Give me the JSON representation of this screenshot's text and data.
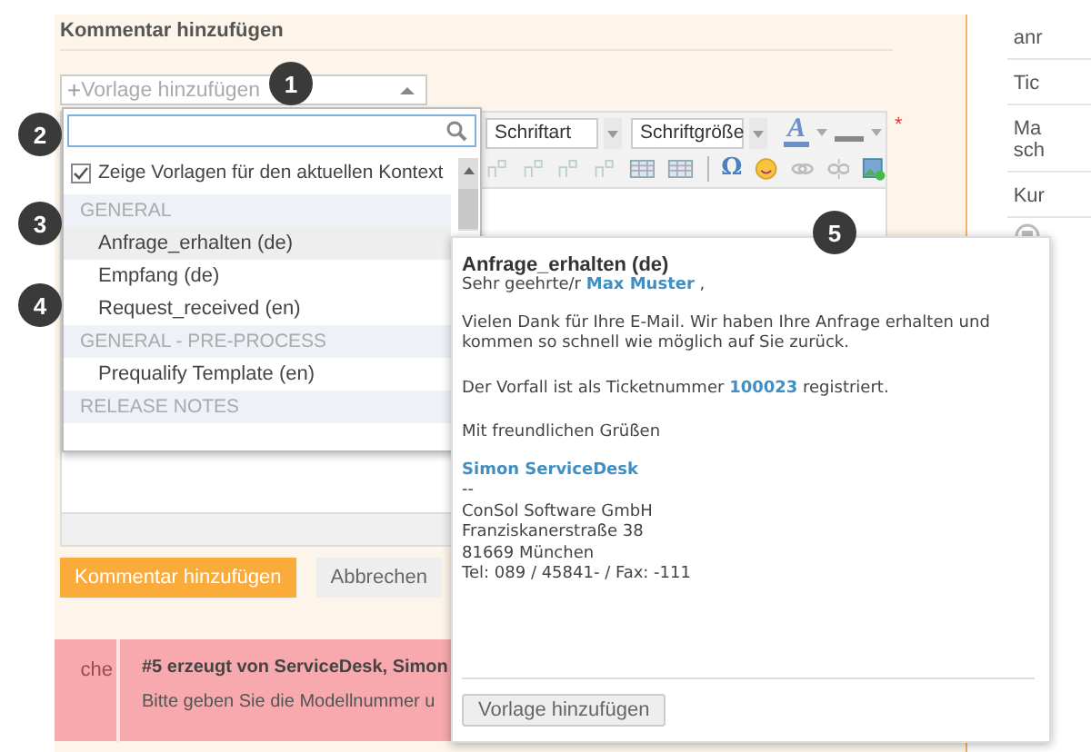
{
  "panel": {
    "title": "Kommentar hinzufügen"
  },
  "template_select": {
    "prefix": "+",
    "placeholder": "Vorlage hinzufügen",
    "expanded": true
  },
  "dropdown": {
    "context_filter": {
      "label": "Zeige Vorlagen für den aktuellen Kontext",
      "checked": true
    },
    "groups": [
      {
        "title": "GENERAL",
        "items": [
          {
            "label": "Anfrage_erhalten (de)",
            "selected": true
          },
          {
            "label": "Empfang (de)",
            "selected": false
          },
          {
            "label": "Request_received (en)",
            "selected": false
          }
        ]
      },
      {
        "title": "GENERAL - PRE-PROCESS",
        "items": [
          {
            "label": "Prequalify Template (en)",
            "selected": false
          }
        ]
      },
      {
        "title": "RELEASE NOTES"
      }
    ]
  },
  "editor": {
    "required_mark": "*",
    "toolbar_row_1": [
      {
        "kind": "select",
        "label": "Schriftart"
      },
      {
        "kind": "select",
        "label": "Schriftgröße"
      },
      {
        "kind": "glyph",
        "text": "A"
      },
      {
        "kind": "bar"
      }
    ],
    "toolbar_row_2": [
      {
        "kind": "row-tool",
        "disabled": true
      },
      {
        "kind": "row-tool",
        "disabled": true
      },
      {
        "kind": "row-tool",
        "disabled": true
      },
      {
        "kind": "row-tool",
        "disabled": true
      },
      {
        "kind": "table",
        "disabled": false
      },
      {
        "kind": "table",
        "disabled": false
      },
      {
        "kind": "glyph",
        "text": "Ω",
        "disabled": false
      },
      {
        "kind": "smiley",
        "disabled": false
      },
      {
        "kind": "link",
        "disabled": true
      },
      {
        "kind": "unlink",
        "disabled": true
      },
      {
        "kind": "image",
        "disabled": false
      }
    ]
  },
  "buttons": [
    {
      "label": "Kommentar hinzufügen",
      "kind": "primary"
    },
    {
      "label": "Abbrechen",
      "kind": "secondary"
    }
  ],
  "history": {
    "side_label": "che",
    "title": "#5 erzeugt von ServiceDesk, Simon",
    "text": "Bitte geben Sie die Modellnummer u"
  },
  "sidebar": {
    "items": [
      {
        "lines": [
          "anr"
        ]
      },
      {
        "lines": [
          "Tic"
        ]
      },
      {
        "lines": [
          "Ma",
          "sch"
        ]
      },
      {
        "lines": [
          "Kur"
        ]
      }
    ]
  },
  "preview": {
    "title": "Anfrage_erhalten (de)",
    "paragraphs": [
      {
        "lines": [
          "Sehr geehrte/r **Max Muster** ,"
        ]
      },
      {
        "lines": [
          "Vielen Dank für Ihre E-Mail. Wir haben Ihre Anfrage erhalten und kommen so schnell wie möglich auf Sie zurück."
        ]
      },
      {
        "lines": [
          "Der Vorfall ist als Ticketnummer **100023** registriert."
        ]
      },
      {
        "lines": [
          "Mit freundlichen Grüßen"
        ]
      },
      {
        "lines": [
          "Simon ServiceDesk",
          "--",
          "ConSol Software GmbH",
          "Franziskanerstraße 38",
          "81669 München",
          "Tel: 089 / 45841- / Fax: -111"
        ]
      }
    ],
    "button": "Vorlage hinzufügen"
  },
  "callouts": [
    "1",
    "2",
    "3",
    "4",
    "5"
  ]
}
